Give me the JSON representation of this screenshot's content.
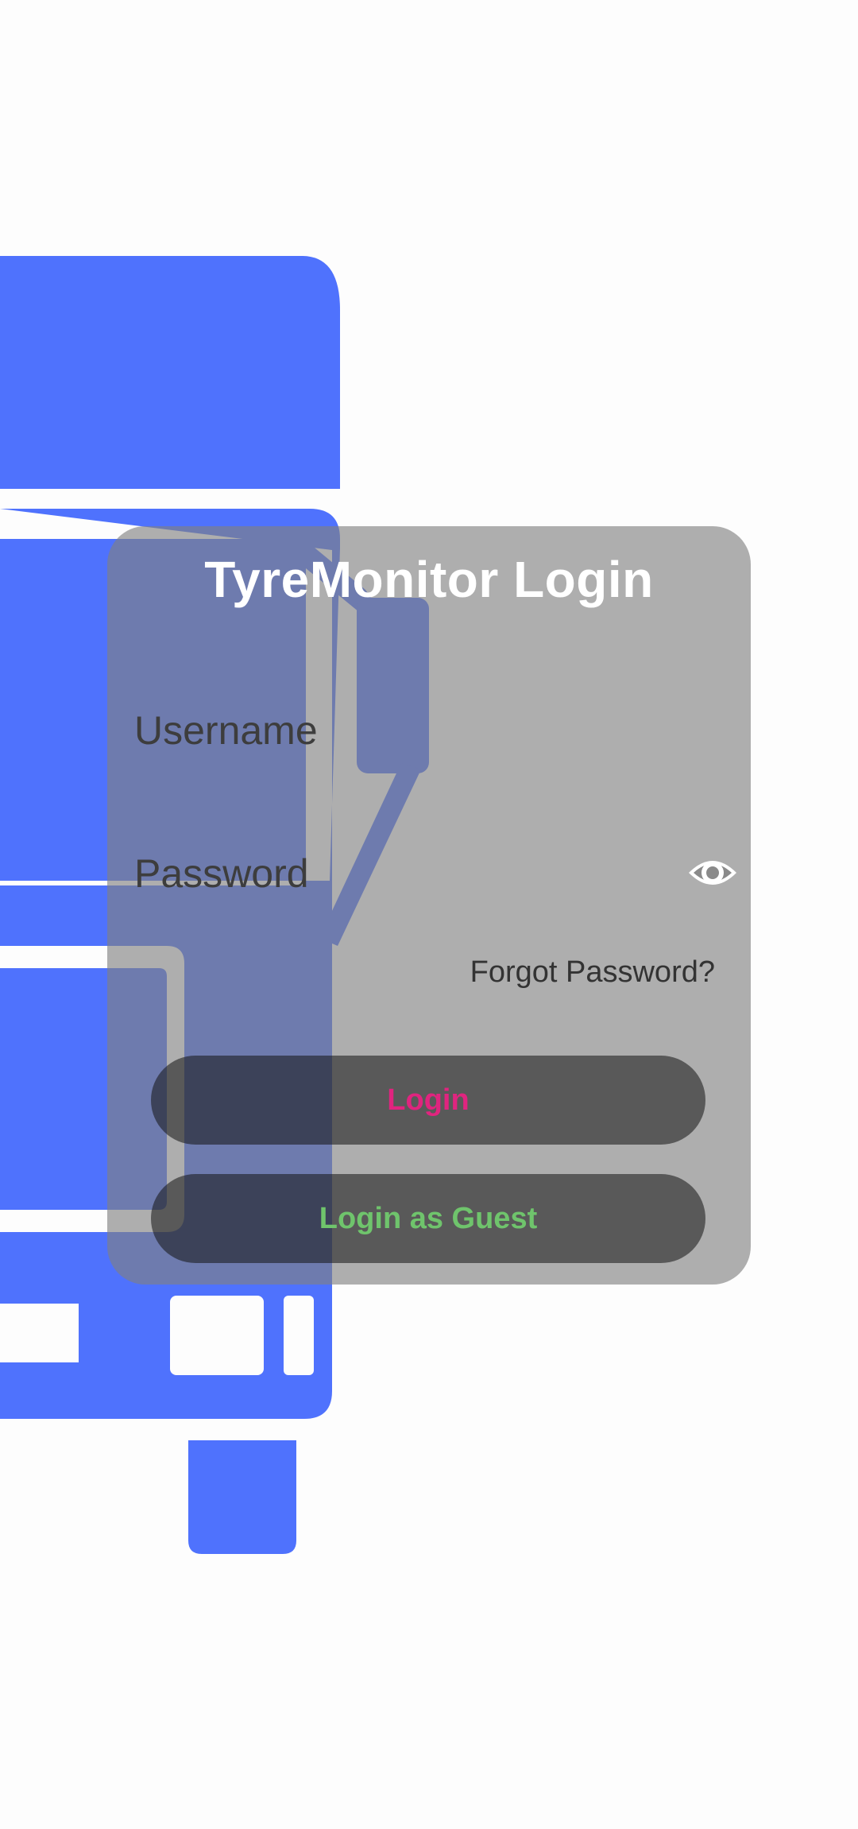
{
  "colors": {
    "background": "#fdfdfd",
    "illustration_blue": "#4f72fd",
    "card_overlay": "#808080",
    "login_text": "#e0247f",
    "guest_text": "#6fc46c"
  },
  "illustration": {
    "icon": "truck-front-icon"
  },
  "login_card": {
    "title": "TyreMonitor Login",
    "username": {
      "placeholder": "Username",
      "value": ""
    },
    "password": {
      "placeholder": "Password",
      "value": "",
      "toggle_icon": "eye-icon"
    },
    "forgot_password": "Forgot Password?",
    "login_button": "Login",
    "guest_button": "Login as Guest"
  }
}
